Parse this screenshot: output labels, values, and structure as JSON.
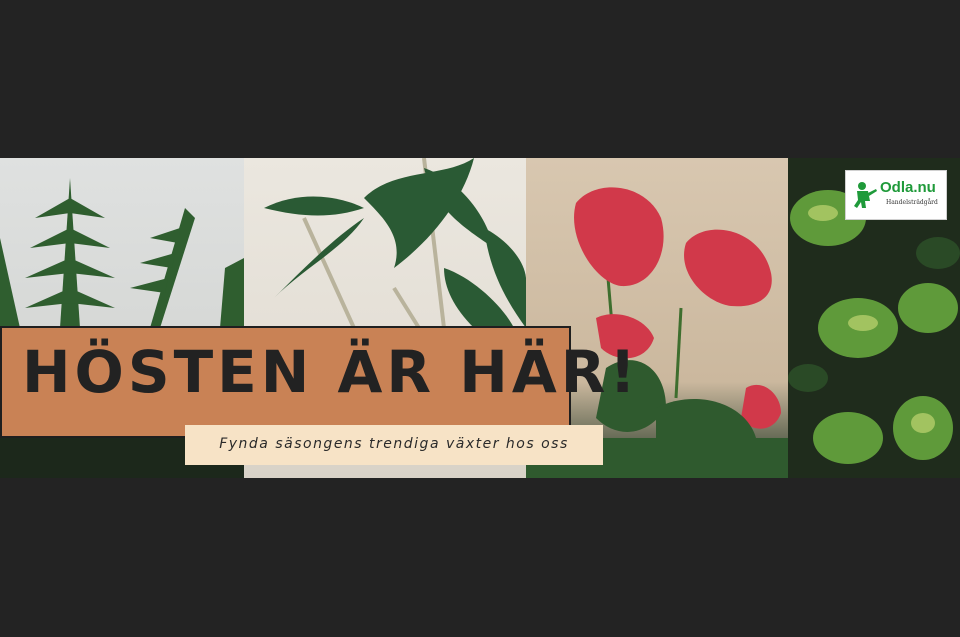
{
  "banner": {
    "headline": "Hösten är här!",
    "subheadline": "Fynda säsongens trendiga växter hos oss",
    "panels": [
      {
        "plant": "fern"
      },
      {
        "plant": "arrowhead-plant"
      },
      {
        "plant": "anthurium"
      },
      {
        "plant": "pothos"
      }
    ]
  },
  "logo": {
    "name": "Odla.nu",
    "tagline": "Handelsträdgård",
    "icon": "gardener-icon",
    "color": "#1f9a3a"
  },
  "colors": {
    "background": "#232323",
    "headline_box": "#c98255",
    "subheadline_box": "#f7e3c6"
  }
}
